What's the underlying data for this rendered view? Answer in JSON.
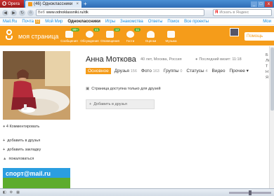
{
  "browser": {
    "menu_label": "Opera",
    "tab_title": "(46) Одноклассники",
    "url_prefix": "Веб",
    "url_host": "www.odnoklassniki.ru/dk",
    "search_placeholder": "Искать в Яндекс",
    "window_buttons": [
      "_",
      "□",
      "x"
    ]
  },
  "mailbar": {
    "items": [
      {
        "label": "Mail.Ru"
      },
      {
        "label": "Почта",
        "badge": "32"
      },
      {
        "label": "Мой Мир"
      },
      {
        "label": "Одноклассники",
        "active": true
      },
      {
        "label": "Игры"
      },
      {
        "label": "Знакомства"
      },
      {
        "label": "Ответы"
      },
      {
        "label": "Поиск"
      },
      {
        "label": "Все проекты"
      }
    ],
    "right_label": "Мои"
  },
  "header": {
    "brand": "моя страница",
    "help": "Помощь",
    "tools": [
      {
        "label": "Сообщения",
        "count": "99+"
      },
      {
        "label": "Обсуждения",
        "count": "41"
      },
      {
        "label": "Оповещения",
        "count": "12"
      },
      {
        "label": "Гости",
        "count": "11"
      },
      {
        "label": "Оценки",
        "count": ""
      },
      {
        "label": "Музыка",
        "count": ""
      }
    ]
  },
  "profile": {
    "name": "Анна Моткова",
    "meta": "40 лет, Москва, Россия",
    "last_visit": "Последний визит: 11:18",
    "tabs": [
      {
        "label": "Основное",
        "count": "",
        "active": true
      },
      {
        "label": "Друзья",
        "count": "156"
      },
      {
        "label": "Фото",
        "count": "163"
      },
      {
        "label": "Группы",
        "count": "0"
      },
      {
        "label": "Статусы",
        "count": "4"
      },
      {
        "label": "Видео",
        "count": ""
      },
      {
        "label": "Прочее ▾",
        "count": ""
      }
    ],
    "private_notice": "Страница доступна только для друзей",
    "add_friend_button": "Добавить в друзья",
    "comments_link": "4 Комментировать"
  },
  "left_links": {
    "add_friend": "добавить в друзья",
    "bookmark": "добавить закладку",
    "complain": "пожаловаться"
  },
  "ad": {
    "text": "спорт@mail.ru"
  },
  "right_sidebar": {
    "items": [
      "Б",
      "Лё",
      "Т",
      "Н",
      "Я"
    ]
  }
}
